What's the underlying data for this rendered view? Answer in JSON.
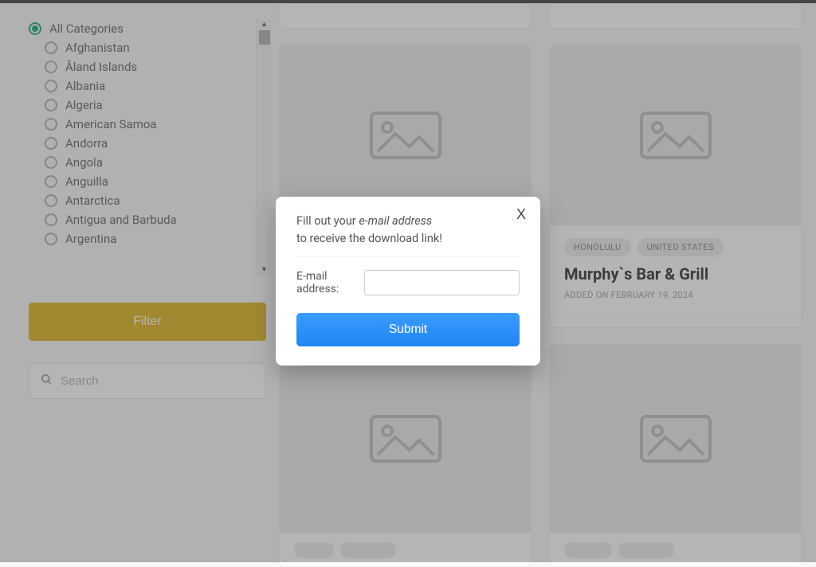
{
  "sidebar": {
    "all_label": "All Categories",
    "categories": [
      "Afghanistan",
      "Åland Islands",
      "Albania",
      "Algeria",
      "American Samoa",
      "Andorra",
      "Angola",
      "Anguilla",
      "Antarctica",
      "Antigua and Barbuda",
      "Argentina"
    ],
    "filter_label": "Filter",
    "search_placeholder": "Search"
  },
  "cards": {
    "honolulu_tag": "HONOLULU",
    "us_tag": "UNITED STATES",
    "murphy_title": "Murphy`s Bar & Grill",
    "murphy_date": "ADDED ON FEBRUARY 19, 2024"
  },
  "modal": {
    "close": "X",
    "line1_prefix": "Fill out your ",
    "line1_em": "e-mail address",
    "line2": "to receive the download link!",
    "label": "E-mail address:",
    "submit": "Submit"
  }
}
